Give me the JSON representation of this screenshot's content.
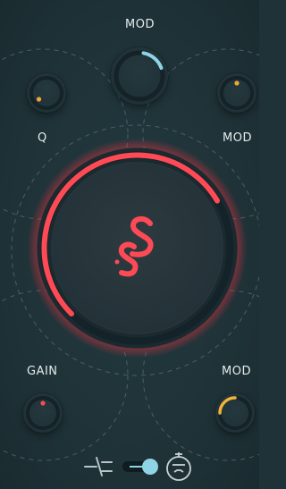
{
  "labels": {
    "mod_top": "MOD",
    "q": "Q",
    "mod_right": "MOD",
    "gain": "GAIN",
    "mod_bottom": "MOD"
  },
  "logo": {
    "text": "S"
  },
  "knobs": {
    "mod_top": {
      "value": 0.18,
      "color": "#8fd4e6"
    },
    "q": {
      "value": 0.02,
      "color": "#f0a53a"
    },
    "mod_right": {
      "value": 0.5,
      "color": "#f0a53a"
    },
    "gain": {
      "value": 0.5,
      "color": "#ff4a55"
    },
    "mod_bottom": {
      "value": 0.35,
      "color": "#f0b23a"
    },
    "main": {
      "value": 0.72,
      "color": "#ff4a55"
    }
  },
  "footer": {
    "toggle_state": "on",
    "left_icon": "plug-icon",
    "right_icon": "tube-icon",
    "accent": "#8fd4e6"
  }
}
